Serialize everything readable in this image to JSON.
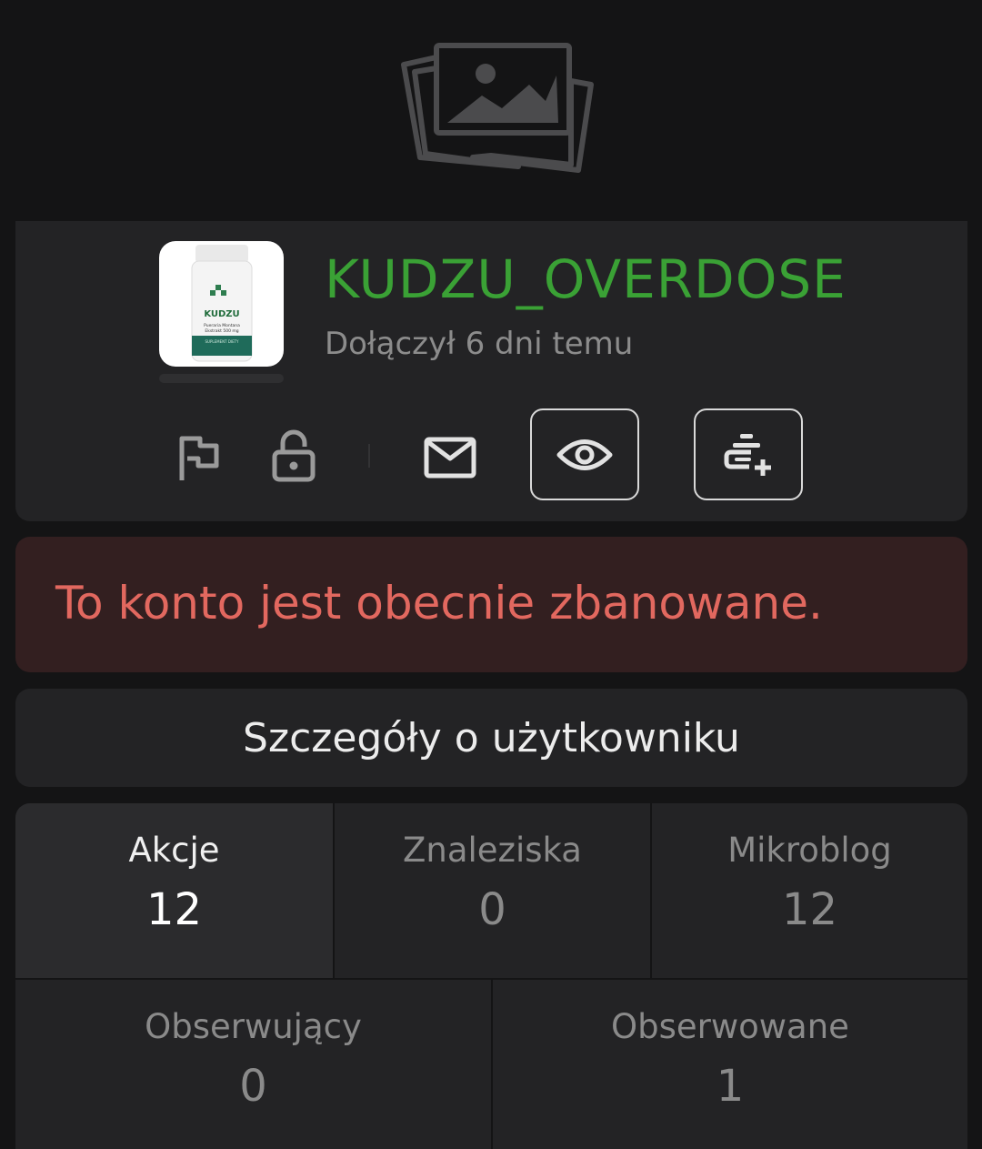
{
  "profile": {
    "username": "KUDZU_OVERDOSE",
    "joined": "Dołączył 6 dni temu",
    "avatar_text": {
      "brand": "KUDZU",
      "line2": "Pueraria Montana",
      "line3": "Ekstrakt 500 mg",
      "line4": "SUPLEMENT DIETY"
    },
    "brand_color": "#3aa135"
  },
  "actions": {
    "icons": [
      "flag-icon",
      "lock-icon",
      "mail-icon",
      "eye-icon",
      "observe-add-icon"
    ]
  },
  "ban": {
    "message": "To konto jest obecnie zbanowane.",
    "color": "#e2685f"
  },
  "details": {
    "label": "Szczegóły o użytkowniku"
  },
  "stats": {
    "akcje": {
      "label": "Akcje",
      "value": "12"
    },
    "znaleziska": {
      "label": "Znaleziska",
      "value": "0"
    },
    "mikroblog": {
      "label": "Mikroblog",
      "value": "12"
    },
    "obserwujacy": {
      "label": "Obserwujący",
      "value": "0"
    },
    "obserwowane": {
      "label": "Obserwowane",
      "value": "1"
    }
  }
}
